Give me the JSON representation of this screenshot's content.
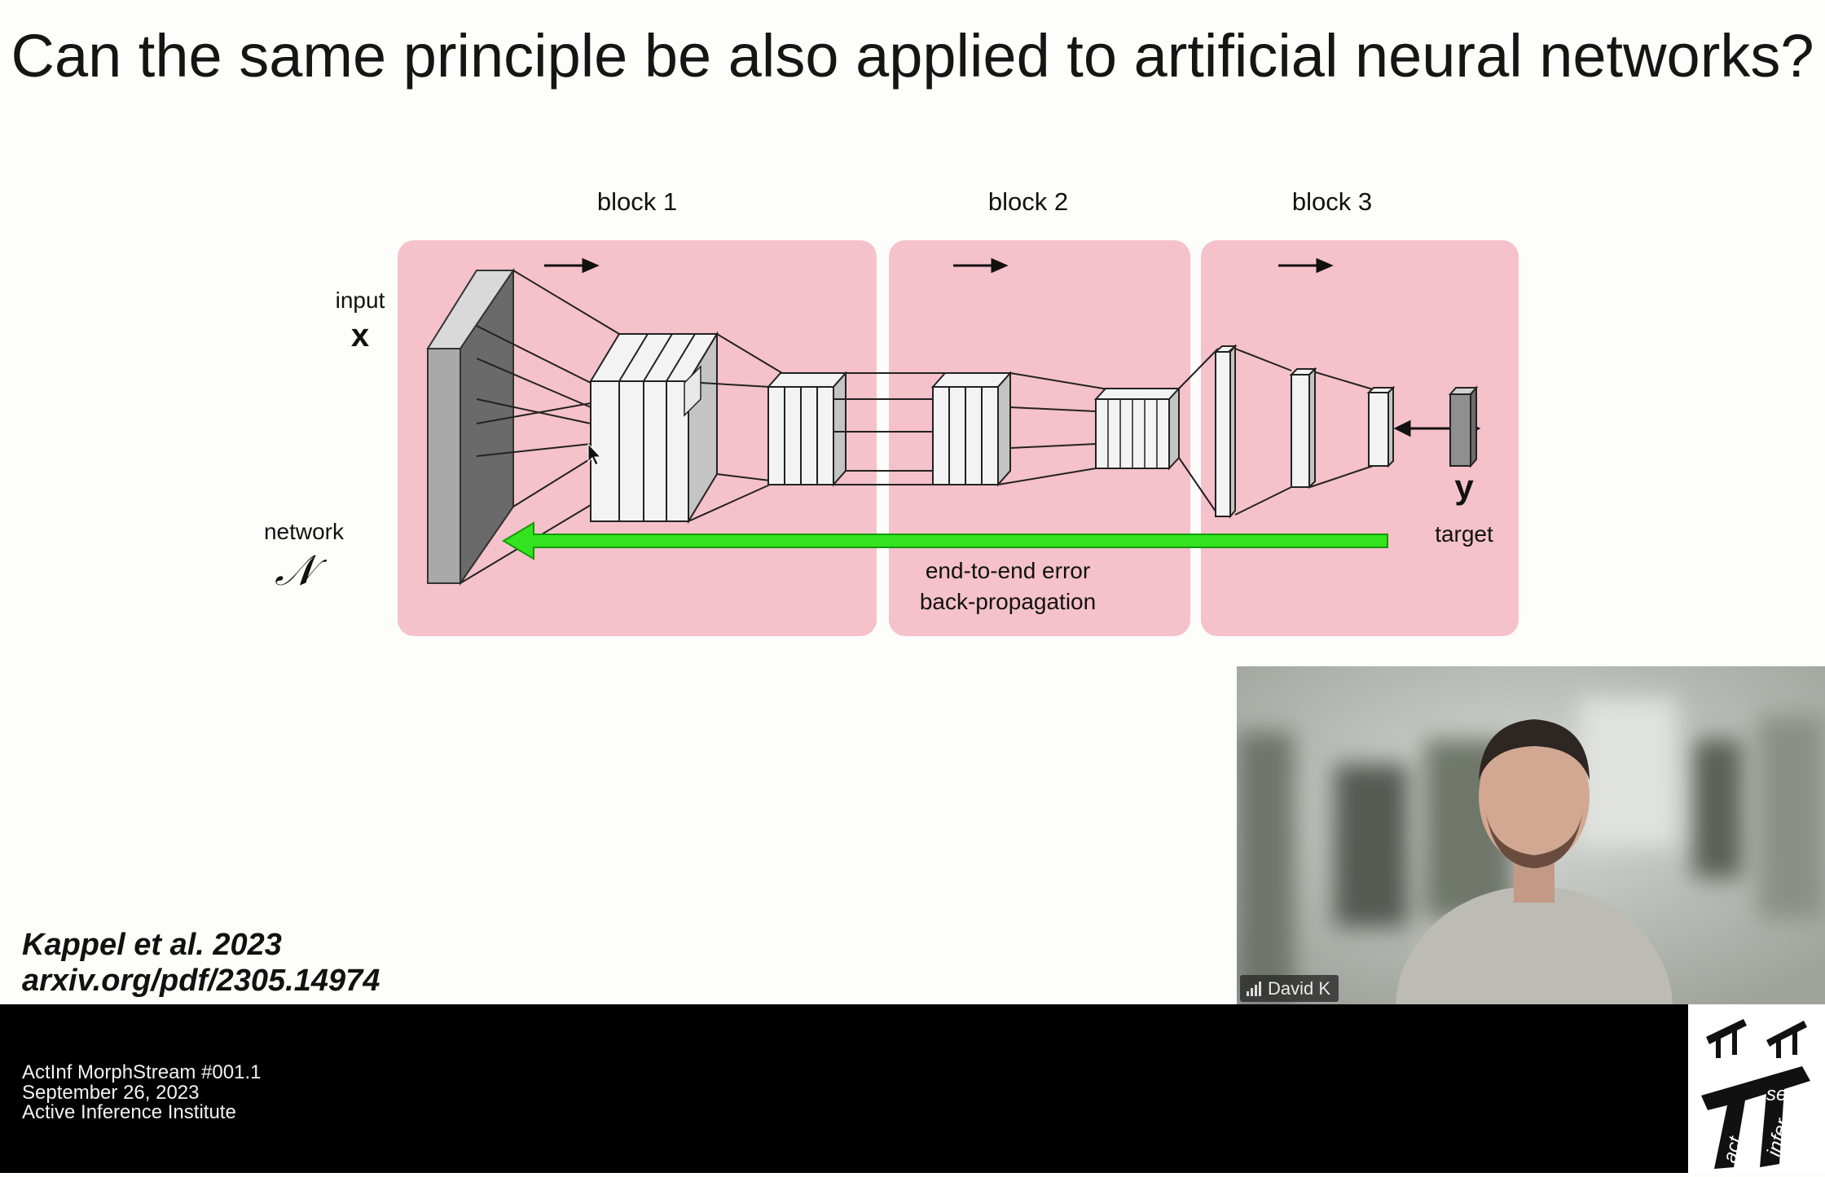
{
  "slide": {
    "title": "Can the same principle be also applied to artificial neural networks?",
    "reference": {
      "author": "Kappel et al. 2023",
      "link": "arxiv.org/pdf/2305.14974"
    }
  },
  "diagram": {
    "block_labels": [
      "block 1",
      "block 2",
      "block 3"
    ],
    "input_label": "input",
    "input_symbol": "x",
    "network_label": "network",
    "network_symbol": "𝒩",
    "target_symbol": "y",
    "target_label": "target",
    "backprop_label_line1": "end-to-end error",
    "backprop_label_line2": "back-propagation",
    "colors": {
      "block_bg": "#f5c1ca",
      "arrow_green": "#2fe024",
      "layer_dark": "#777777",
      "layer_light": "#ececec"
    }
  },
  "video": {
    "participant_name": "David K",
    "icons": [
      "signal-bars-icon"
    ]
  },
  "footer": {
    "line1": "ActInf MorphStream #001.1",
    "line2": "September 26, 2023",
    "line3": "Active Inference Institute"
  },
  "logo": {
    "words": [
      "serve",
      "act",
      "infer"
    ],
    "icons": [
      "pi-logo-icon"
    ]
  }
}
